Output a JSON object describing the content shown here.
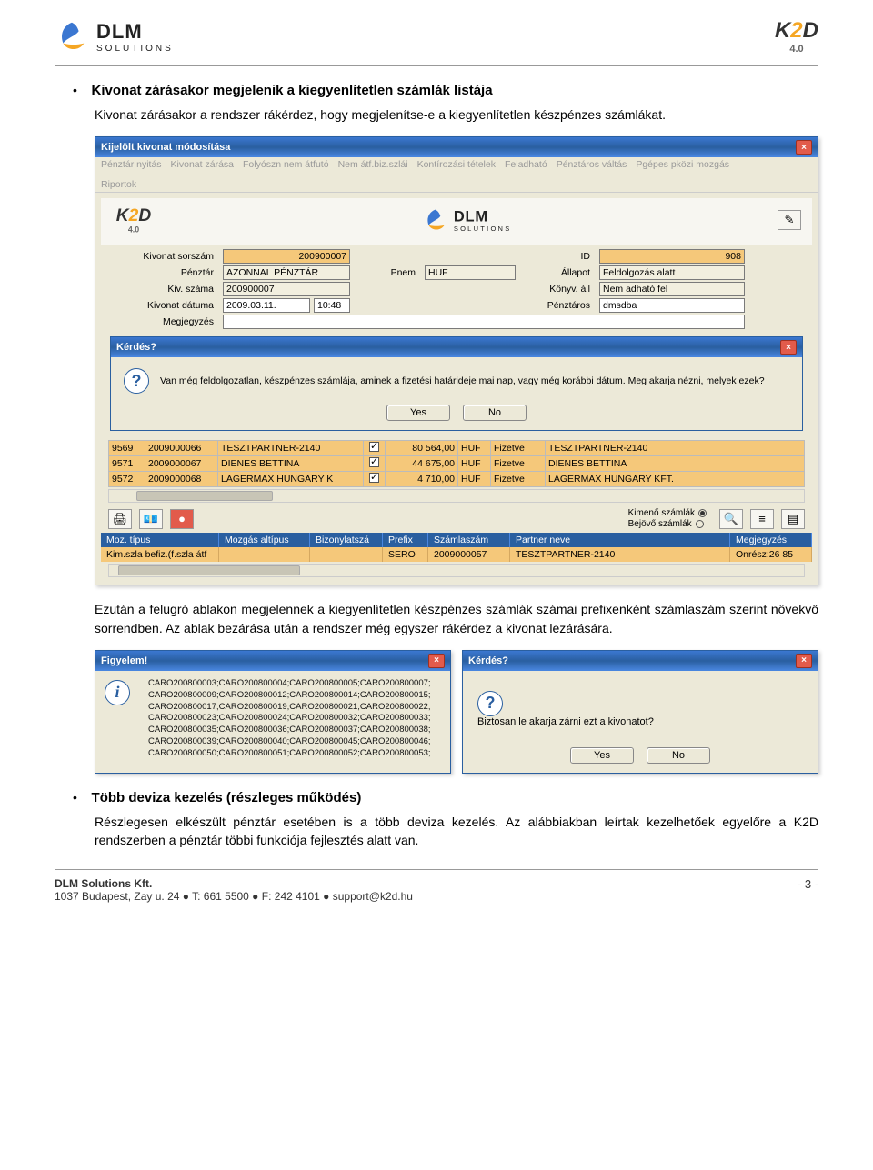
{
  "header": {
    "dlm_brand": "DLM",
    "dlm_sub": "SOLUTIONS",
    "k2d_brand_k": "K",
    "k2d_brand_2": "2",
    "k2d_brand_d": "D",
    "k2d_sub": "4.0"
  },
  "bullet1": {
    "title": "Kivonat zárásakor megjelenik a kiegyenlítetlen számlák listája",
    "para": "Kivonat zárásakor a rendszer rákérdez, hogy megjelenítse-e a kiegyenlítetlen készpénzes számlákat."
  },
  "main_window": {
    "title": "Kijelölt kivonat módosítása",
    "menu": [
      "Pénztár nyitás",
      "Kivonat zárása",
      "Folyószn nem átfutó",
      "Nem átf.biz.szlái",
      "Kontírozási tételek",
      "Feladható",
      "Pénztáros váltás",
      "Pgépes pközi mozgás",
      "Riportok"
    ],
    "form": {
      "kivonat_sorszam_label": "Kivonat sorszám",
      "kivonat_sorszam": "200900007",
      "id_label": "ID",
      "id": "908",
      "penztar_label": "Pénztár",
      "penztar": "AZONNAL PÉNZTÁR",
      "pnem_label": "Pnem",
      "pnem": "HUF",
      "allapot_label": "Állapot",
      "allapot": "Feldolgozás alatt",
      "kiv_szama_label": "Kiv. száma",
      "kiv_szama": "200900007",
      "konyv_label": "Könyv. áll",
      "konyv": "Nem adható fel",
      "kivonat_datuma_label": "Kivonat dátuma",
      "kivonat_datuma": "2009.03.11.",
      "kivonat_ido": "10:48",
      "penztaros_label": "Pénztáros",
      "penztaros": "dmsdba",
      "megjegyzes_label": "Megjegyzés"
    },
    "question": {
      "title": "Kérdés?",
      "text": "Van még feldolgozatlan, készpénzes számlája, aminek a fizetési határideje mai nap, vagy még korábbi dátum. Meg akarja nézni, melyek ezek?",
      "yes": "Yes",
      "no": "No"
    },
    "rows": [
      {
        "c0": "9569",
        "c1": "2009000066",
        "c2": "TESZTPARTNER-2140",
        "chk": true,
        "c3": "80 564,00",
        "c4": "HUF",
        "c5": "Fizetve",
        "c6": "TESZTPARTNER-2140"
      },
      {
        "c0": "9571",
        "c1": "2009000067",
        "c2": "DIENES BETTINA",
        "chk": true,
        "c3": "44 675,00",
        "c4": "HUF",
        "c5": "Fizetve",
        "c6": "DIENES BETTINA"
      },
      {
        "c0": "9572",
        "c1": "2009000068",
        "c2": "LAGERMAX HUNGARY K",
        "chk": true,
        "c3": "4 710,00",
        "c4": "HUF",
        "c5": "Fizetve",
        "c6": "LAGERMAX HUNGARY KFT."
      }
    ],
    "radios": {
      "kimeno": "Kimenő számlák",
      "bejovo": "Bejövő számlák"
    },
    "headers2": [
      "Moz. típus",
      "Mozgás altípus",
      "Bizonylatszá",
      "Prefix",
      "Számlaszám",
      "Partner neve",
      "Megjegyzés"
    ],
    "line2": [
      "Kim.szla befiz.(f.szla átf",
      "",
      "",
      "SERO",
      "2009000057",
      "TESZTPARTNER-2140",
      "Onrész:26 85"
    ]
  },
  "after_para": "Ezután a felugró ablakon megjelennek a kiegyenlítetlen készpénzes számlák számai prefixenként számlaszám szerint növekvő sorrendben. Az ablak bezárása után a rendszer még egyszer rákérdez a kivonat lezárására.",
  "figyelem": {
    "title": "Figyelem!",
    "lines": [
      "CARO200800003;CARO200800004;CARO200800005;CARO200800007;",
      "CARO200800009;CARO200800012;CARO200800014;CARO200800015;",
      "CARO200800017;CARO200800019;CARO200800021;CARO200800022;",
      "CARO200800023;CARO200800024;CARO200800032;CARO200800033;",
      "CARO200800035;CARO200800036;CARO200800037;CARO200800038;",
      "CARO200800039;CARO200800040;CARO200800045;CARO200800046;",
      "CARO200800050;CARO200800051;CARO200800052;CARO200800053;"
    ]
  },
  "kerdes2": {
    "title": "Kérdés?",
    "text": "Biztosan le akarja zárni ezt a kivonatot?",
    "yes": "Yes",
    "no": "No"
  },
  "bullet2": {
    "title": "Több deviza kezelés (részleges működés)",
    "para": "Részlegesen elkészült pénztár esetében is a több deviza kezelés. Az alábbiakban leírtak kezelhetőek egyelőre a K2D rendszerben a pénztár többi funkciója fejlesztés alatt van."
  },
  "footer": {
    "company": "DLM Solutions Kft.",
    "address": "1037 Budapest, Zay u. 24 ● T: 661 5500 ● F: 242 4101 ● support@k2d.hu",
    "page": "- 3 -"
  }
}
